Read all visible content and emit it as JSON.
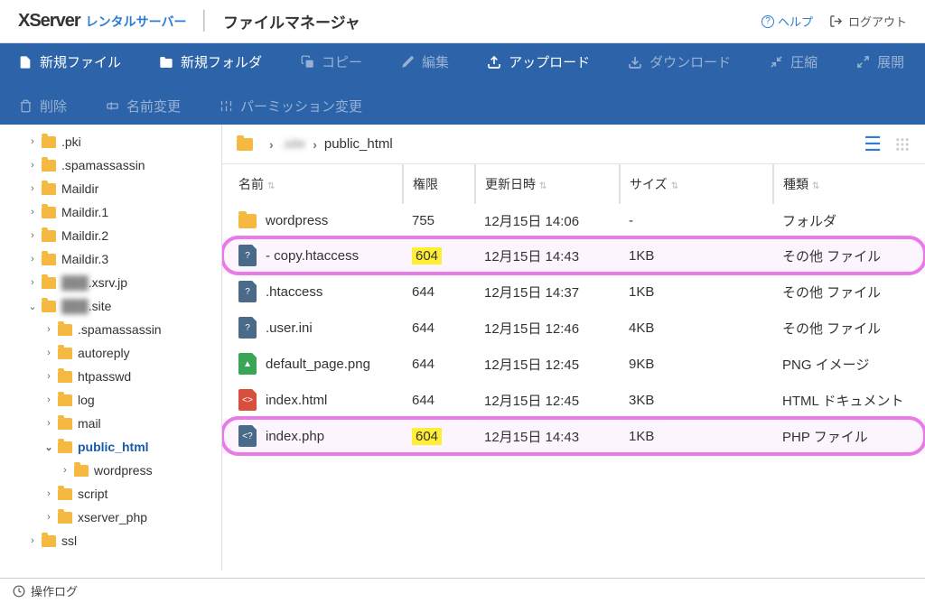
{
  "header": {
    "logo_main": "XServer",
    "logo_sub": "レンタルサーバー",
    "logo_title": "ファイルマネージャ",
    "help": "ヘルプ",
    "logout": "ログアウト"
  },
  "toolbar": {
    "new_file": "新規ファイル",
    "new_folder": "新規フォルダ",
    "copy": "コピー",
    "edit": "編集",
    "upload": "アップロード",
    "download": "ダウンロード",
    "compress": "圧縮",
    "expand": "展開",
    "delete": "削除",
    "rename": "名前変更",
    "permission": "パーミッション変更"
  },
  "tree": [
    {
      "label": ".pki",
      "indent": 1,
      "closed": true
    },
    {
      "label": ".spamassassin",
      "indent": 1,
      "closed": true
    },
    {
      "label": "Maildir",
      "indent": 1,
      "closed": true
    },
    {
      "label": "Maildir.1",
      "indent": 1,
      "closed": true
    },
    {
      "label": "Maildir.2",
      "indent": 1,
      "closed": true
    },
    {
      "label": "Maildir.3",
      "indent": 1,
      "closed": true
    },
    {
      "label": ".xsrv.jp",
      "indent": 1,
      "closed": true,
      "blur": true
    },
    {
      "label": ".site",
      "indent": 1,
      "closed": false,
      "blur": true
    },
    {
      "label": ".spamassassin",
      "indent": 2,
      "closed": true
    },
    {
      "label": "autoreply",
      "indent": 2,
      "closed": true
    },
    {
      "label": "htpasswd",
      "indent": 2,
      "closed": true
    },
    {
      "label": "log",
      "indent": 2,
      "closed": true
    },
    {
      "label": "mail",
      "indent": 2,
      "closed": true
    },
    {
      "label": "public_html",
      "indent": 2,
      "closed": false,
      "active": true
    },
    {
      "label": "wordpress",
      "indent": 3,
      "closed": true
    },
    {
      "label": "script",
      "indent": 2,
      "closed": true
    },
    {
      "label": "xserver_php",
      "indent": 2,
      "closed": true
    },
    {
      "label": "ssl",
      "indent": 1,
      "closed": true
    }
  ],
  "breadcrumb": {
    "seg1": ".site",
    "seg2": "public_html"
  },
  "columns": {
    "name": "名前",
    "perm": "権限",
    "date": "更新日時",
    "size": "サイズ",
    "type": "種類"
  },
  "rows": [
    {
      "icon": "folder",
      "name": "wordpress",
      "perm": "755",
      "date": "12月15日 14:06",
      "size": "-",
      "type": "フォルダ"
    },
    {
      "icon": "question",
      "name": "- copy.htaccess",
      "perm": "604",
      "perm_hl": true,
      "date": "12月15日 14:43",
      "size": "1KB",
      "type": "その他 ファイル",
      "highlight": true
    },
    {
      "icon": "question",
      "name": ".htaccess",
      "perm": "644",
      "date": "12月15日 14:37",
      "size": "1KB",
      "type": "その他 ファイル"
    },
    {
      "icon": "question",
      "name": ".user.ini",
      "perm": "644",
      "date": "12月15日 12:46",
      "size": "4KB",
      "type": "その他 ファイル"
    },
    {
      "icon": "png",
      "name": "default_page.png",
      "perm": "644",
      "date": "12月15日 12:45",
      "size": "9KB",
      "type": "PNG イメージ"
    },
    {
      "icon": "html",
      "name": "index.html",
      "perm": "644",
      "date": "12月15日 12:45",
      "size": "3KB",
      "type": "HTML ドキュメント"
    },
    {
      "icon": "php",
      "name": "index.php",
      "perm": "604",
      "perm_hl": true,
      "date": "12月15日 14:43",
      "size": "1KB",
      "type": "PHP ファイル",
      "highlight": true
    }
  ],
  "footer": {
    "log": "操作ログ"
  }
}
